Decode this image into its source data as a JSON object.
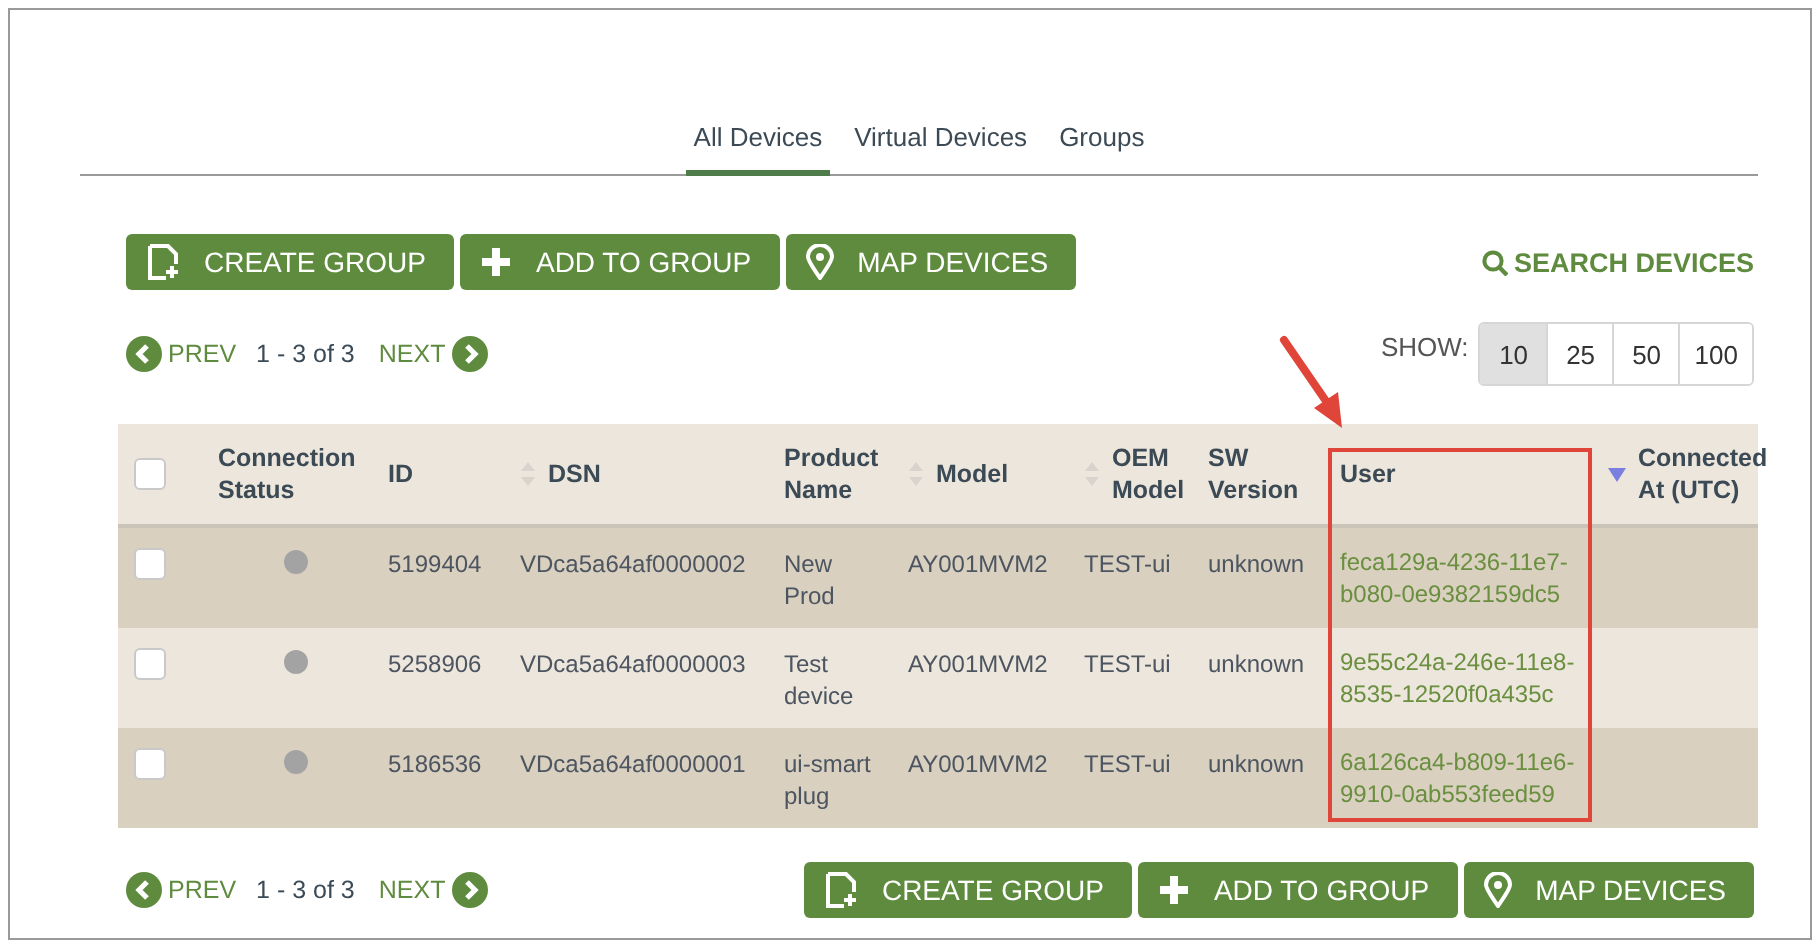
{
  "tabs": [
    {
      "label": "All Devices",
      "selected": true
    },
    {
      "label": "Virtual Devices",
      "selected": false
    },
    {
      "label": "Groups",
      "selected": false
    }
  ],
  "top_actions": [
    {
      "label": "CREATE GROUP",
      "kind": "create"
    },
    {
      "label": "ADD TO GROUP",
      "kind": "add"
    },
    {
      "label": "MAP DEVICES",
      "kind": "map"
    }
  ],
  "search_link": "SEARCH DEVICES",
  "pager_top": {
    "prev": "PREV",
    "range": "1 - 3 of 3",
    "next": "NEXT"
  },
  "page_size": {
    "label": "SHOW:",
    "options": [
      {
        "label": "10",
        "selected": true
      },
      {
        "label": "25",
        "selected": false
      },
      {
        "label": "50",
        "selected": false
      },
      {
        "label": "100",
        "selected": false
      }
    ]
  },
  "table": {
    "select_all_checked": false,
    "columns": [
      {
        "label": "Connection Status",
        "kind": "plain"
      },
      {
        "label": "ID",
        "kind": "plain"
      },
      {
        "label": "DSN",
        "kind": "sortable"
      },
      {
        "label": "Product Name",
        "kind": "plain"
      },
      {
        "label": "Model",
        "kind": "sortable"
      },
      {
        "label": "OEM Model",
        "kind": "sortable"
      },
      {
        "label": "SW Version",
        "kind": "plain"
      },
      {
        "label": "User",
        "kind": "highlighted"
      },
      {
        "label": "Connected At (UTC)",
        "kind": "sorted"
      }
    ],
    "rows": [
      {
        "checked": false,
        "connected": false,
        "id": "5199404",
        "dsn": "VDca5a64af0000002",
        "product": "New Prod",
        "model": "AY001MVM2",
        "oem_model": "TEST-ui",
        "sw_version": "unknown",
        "user": "feca129a-4236-11e7-b080-0e9382159dc5"
      },
      {
        "checked": false,
        "connected": false,
        "id": "5258906",
        "dsn": "VDca5a64af0000003",
        "product": "Test device",
        "model": "AY001MVM2",
        "oem_model": "TEST-ui",
        "sw_version": "unknown",
        "user": "9e55c24a-246e-11e8-8535-12520f0a435c"
      },
      {
        "checked": false,
        "connected": false,
        "id": "5186536",
        "dsn": "VDca5a64af0000001",
        "product": "ui-smart plug",
        "model": "AY001MVM2",
        "oem_model": "TEST-ui",
        "sw_version": "unknown",
        "user": "6a126ca4-b809-11e6-9910-0ab553feed59"
      }
    ]
  },
  "pager_bottom": {
    "prev": "PREV",
    "range": "1 - 3 of 3",
    "next": "NEXT"
  },
  "bottom_actions": [
    {
      "label": "CREATE GROUP",
      "kind": "create"
    },
    {
      "label": "ADD TO GROUP",
      "kind": "add"
    },
    {
      "label": "MAP DEVICES",
      "kind": "map"
    }
  ]
}
